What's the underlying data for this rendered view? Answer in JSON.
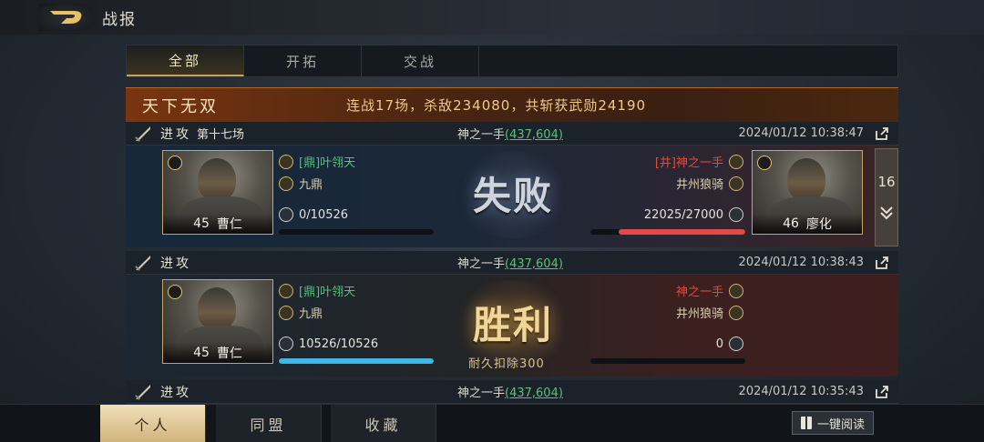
{
  "header": {
    "title": "战报"
  },
  "tabs": [
    {
      "label": "全部",
      "active": true
    },
    {
      "label": "开拓",
      "active": false
    },
    {
      "label": "交战",
      "active": false
    }
  ],
  "banner": {
    "title": "天下无双",
    "stats": "连战17场，杀敌234080，共斩获武勋24190"
  },
  "reports": [
    {
      "attack_label": "进攻",
      "round_label": "第十七场",
      "opponent_name": "神之一手",
      "opponent_coord": "(437,604)",
      "time": "2024/01/12 10:38:47",
      "result": "失败",
      "left": {
        "level": "45",
        "hero": "曹仁",
        "player": "[鼎]叶翎天",
        "alliance": "九鼎",
        "troops": "0/10526",
        "troop_ratio": 0.0
      },
      "right": {
        "level": "46",
        "hero": "廖化",
        "player": "[井]神之一手",
        "alliance": "井州狼骑",
        "troops": "22025/27000",
        "troop_ratio": 0.8157
      }
    },
    {
      "attack_label": "进攻",
      "opponent_name": "神之一手",
      "opponent_coord": "(437,604)",
      "time": "2024/01/12 10:38:43",
      "result": "胜利",
      "durability_text": "耐久扣除300",
      "left": {
        "level": "45",
        "hero": "曹仁",
        "player": "[鼎]叶翎天",
        "alliance": "九鼎",
        "troops": "10526/10526",
        "troop_ratio": 1.0
      },
      "right": {
        "player": "神之一手",
        "alliance": "井州狼骑",
        "troops": "0",
        "troop_ratio": 0.0
      }
    },
    {
      "attack_label": "进攻",
      "opponent_name": "神之一手",
      "opponent_coord": "(437,604)",
      "time": "2024/01/12 10:35:43"
    }
  ],
  "side_counter": {
    "count": "16"
  },
  "bottom_tabs": [
    {
      "label": "个人",
      "active": true
    },
    {
      "label": "同盟",
      "active": false
    },
    {
      "label": "收藏",
      "active": false
    }
  ],
  "read_all_label": "一键阅读",
  "colors": {
    "accent_gold": "#c9a25a",
    "player_green": "#58c07c",
    "enemy_red": "#e24a3f",
    "coord_green": "#5bc07a"
  }
}
